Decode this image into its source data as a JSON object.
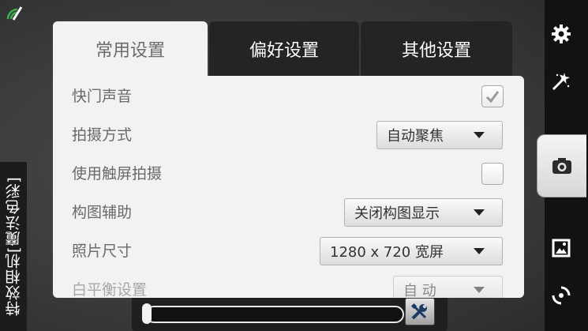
{
  "app": {
    "vertical_title": "特效相机[魔法色彩]"
  },
  "tabs": [
    {
      "label": "常用设置",
      "active": true
    },
    {
      "label": "偏好设置",
      "active": false
    },
    {
      "label": "其他设置",
      "active": false
    }
  ],
  "settings": [
    {
      "label": "快门声音",
      "control": "checkbox",
      "checked": true
    },
    {
      "label": "拍摄方式",
      "control": "dropdown",
      "value": "自动聚焦"
    },
    {
      "label": "使用触屏拍摄",
      "control": "checkbox",
      "checked": false
    },
    {
      "label": "构图辅助",
      "control": "dropdown",
      "value": "关闭构图显示"
    },
    {
      "label": "照片尺寸",
      "control": "dropdown",
      "value": "1280 x 720  宽屏"
    },
    {
      "label": "白平衡设置",
      "control": "dropdown",
      "value": "自 动"
    }
  ],
  "right_bar": {
    "icons": [
      "gear-icon",
      "effects-wand-icon",
      "camera-icon",
      "gallery-icon",
      "switch-camera-icon"
    ]
  },
  "slider": {
    "level": 0.0
  },
  "colors": {
    "panel_bg": "#f2f2f2",
    "tab_inactive_bg": "#242424",
    "sidebar_bg": "#121212"
  }
}
